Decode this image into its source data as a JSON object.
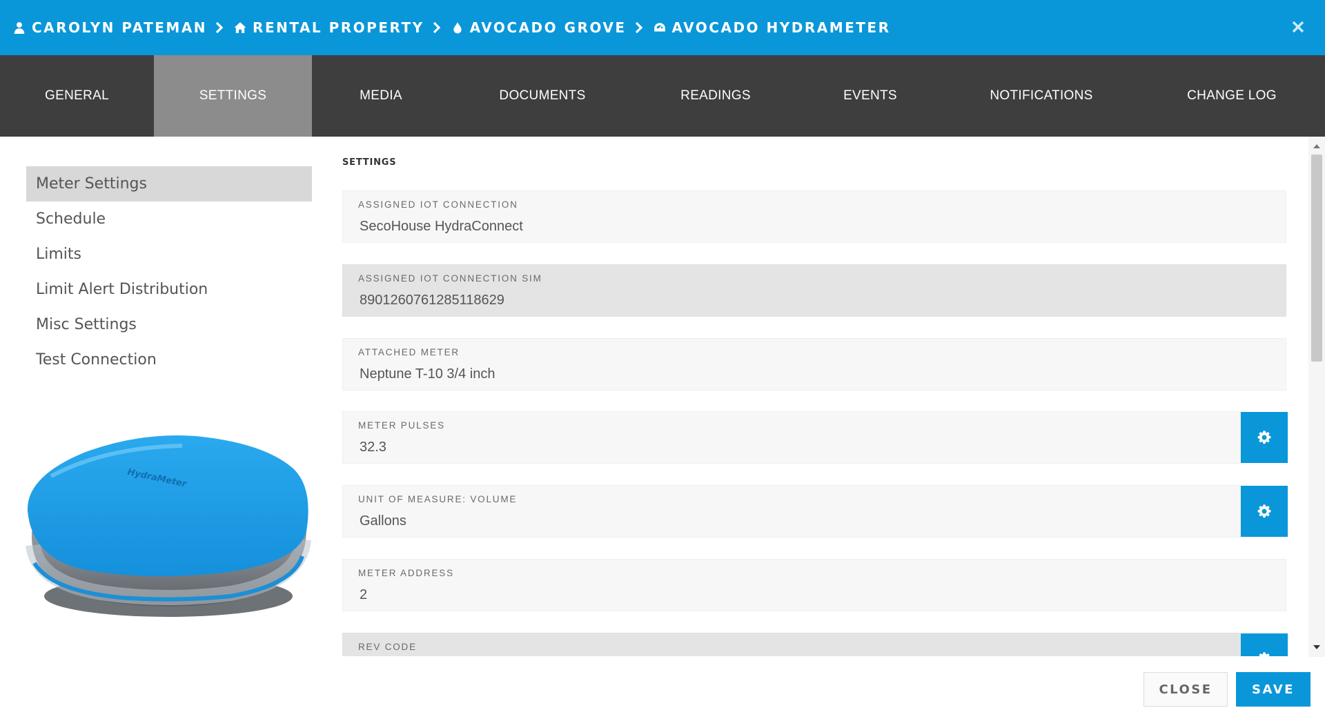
{
  "breadcrumb": [
    {
      "label": "CAROLYN PATEMAN",
      "icon": "user-icon"
    },
    {
      "label": "RENTAL PROPERTY",
      "icon": "home-icon"
    },
    {
      "label": "AVOCADO GROVE",
      "icon": "water-drop-icon"
    },
    {
      "label": "AVOCADO HYDRAMETER",
      "icon": "meter-gauge-icon"
    }
  ],
  "tabs": [
    {
      "label": "GENERAL",
      "active": false
    },
    {
      "label": "SETTINGS",
      "active": true
    },
    {
      "label": "MEDIA",
      "active": false
    },
    {
      "label": "DOCUMENTS",
      "active": false
    },
    {
      "label": "READINGS",
      "active": false
    },
    {
      "label": "EVENTS",
      "active": false
    },
    {
      "label": "NOTIFICATIONS",
      "active": false
    },
    {
      "label": "CHANGE LOG",
      "active": false
    }
  ],
  "sidebar": {
    "items": [
      {
        "label": "Meter Settings",
        "active": true
      },
      {
        "label": "Schedule",
        "active": false
      },
      {
        "label": "Limits",
        "active": false
      },
      {
        "label": "Limit Alert Distribution",
        "active": false
      },
      {
        "label": "Misc Settings",
        "active": false
      },
      {
        "label": "Test Connection",
        "active": false
      }
    ],
    "device_logo_text": "HydraMeter"
  },
  "settings": {
    "title": "SETTINGS",
    "fields": [
      {
        "label": "ASSIGNED IOT CONNECTION",
        "value": "SecoHouse HydraConnect",
        "has_button": false,
        "shaded": false
      },
      {
        "label": "ASSIGNED IOT CONNECTION SIM",
        "value": "8901260761285118629",
        "has_button": false,
        "shaded": true
      },
      {
        "label": "ATTACHED METER",
        "value": "Neptune T-10 3/4 inch",
        "has_button": false,
        "shaded": false
      },
      {
        "label": "METER PULSES",
        "value": "32.3",
        "has_button": true,
        "shaded": false
      },
      {
        "label": "UNIT OF MEASURE: VOLUME",
        "value": "Gallons",
        "has_button": true,
        "shaded": false
      },
      {
        "label": "METER ADDRESS",
        "value": "2",
        "has_button": false,
        "shaded": false
      },
      {
        "label": "REV CODE",
        "value": "",
        "has_button": true,
        "shaded": true
      }
    ]
  },
  "footer": {
    "close_label": "CLOSE",
    "save_label": "SAVE"
  },
  "colors": {
    "accent": "#0a97d9",
    "tabbar": "#3e3e3e",
    "tab_active": "#8c8c8c"
  }
}
